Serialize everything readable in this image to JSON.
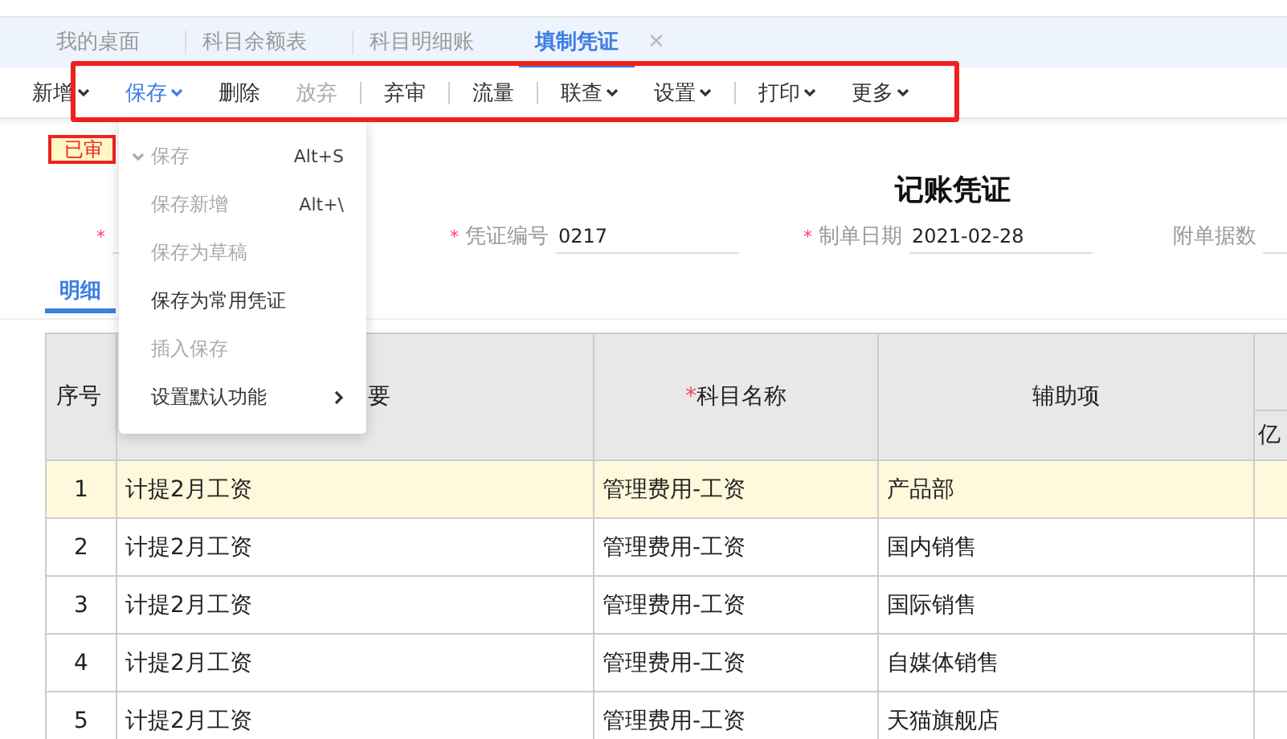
{
  "tabs": [
    {
      "label": "我的桌面",
      "selected": false
    },
    {
      "label": "科目余额表",
      "selected": false
    },
    {
      "label": "科目明细账",
      "selected": false
    },
    {
      "label": "填制凭证",
      "selected": true,
      "close": "✕"
    }
  ],
  "toolbar": [
    {
      "kind": "dropdown",
      "label": "新增",
      "open": false,
      "disabled": false
    },
    {
      "kind": "dropdown",
      "label": "保存",
      "open": true,
      "disabled": false
    },
    {
      "kind": "button",
      "label": "删除",
      "open": false,
      "disabled": false
    },
    {
      "kind": "button",
      "label": "放弃",
      "open": false,
      "disabled": true
    },
    {
      "kind": "separator"
    },
    {
      "kind": "button",
      "label": "弃审",
      "open": false,
      "disabled": false
    },
    {
      "kind": "separator"
    },
    {
      "kind": "button",
      "label": "流量",
      "open": false,
      "disabled": false
    },
    {
      "kind": "separator"
    },
    {
      "kind": "dropdown",
      "label": "联查",
      "open": false,
      "disabled": false
    },
    {
      "kind": "dropdown",
      "label": "设置",
      "open": false,
      "disabled": false
    },
    {
      "kind": "separator"
    },
    {
      "kind": "dropdown",
      "label": "打印",
      "open": false,
      "disabled": false
    },
    {
      "kind": "dropdown",
      "label": "更多",
      "open": false,
      "disabled": false
    }
  ],
  "menu": [
    {
      "label": "保存",
      "shortcut": "Alt+S",
      "disabled": true,
      "marked": true,
      "submenu": false
    },
    {
      "label": "保存新增",
      "shortcut": "Alt+\\",
      "disabled": true,
      "marked": false,
      "submenu": false
    },
    {
      "label": "保存为草稿",
      "disabled": true,
      "marked": false,
      "submenu": false
    },
    {
      "label": "保存为常用凭证",
      "disabled": false,
      "marked": false,
      "submenu": false
    },
    {
      "label": "插入保存",
      "disabled": true,
      "marked": false,
      "submenu": false
    },
    {
      "label": "设置默认功能",
      "disabled": false,
      "marked": false,
      "submenu": true
    }
  ],
  "stamp": "已审",
  "voucher_title": "记账凭证",
  "fields": [
    {
      "mark": "*"
    },
    {
      "mark": "*",
      "label": "凭证编号",
      "value": "0217"
    },
    {
      "mark": "*",
      "label": "制单日期",
      "value": "2021-02-28"
    },
    {
      "label": "附单据数"
    }
  ],
  "detail_tabs": [
    {
      "label": "明细",
      "selected": true
    }
  ],
  "table": {
    "columns": [
      {
        "label": "序号"
      },
      {
        "label": "要"
      },
      {
        "mark": "*",
        "label": "科目名称"
      },
      {
        "label": "辅助项"
      },
      {
        "label": "亿"
      }
    ],
    "rows": [
      {
        "cells": [
          "1",
          "计提2月工资",
          "管理费用-工资",
          "产品部"
        ],
        "selected": true
      },
      {
        "cells": [
          "2",
          "计提2月工资",
          "管理费用-工资",
          "国内销售"
        ],
        "selected": false
      },
      {
        "cells": [
          "3",
          "计提2月工资",
          "管理费用-工资",
          "国际销售"
        ],
        "selected": false
      },
      {
        "cells": [
          "4",
          "计提2月工资",
          "管理费用-工资",
          "自媒体销售"
        ],
        "selected": false
      },
      {
        "cells": [
          "5",
          "计提2月工资",
          "管理费用-工资",
          "天猫旗舰店"
        ],
        "selected": false
      }
    ]
  }
}
